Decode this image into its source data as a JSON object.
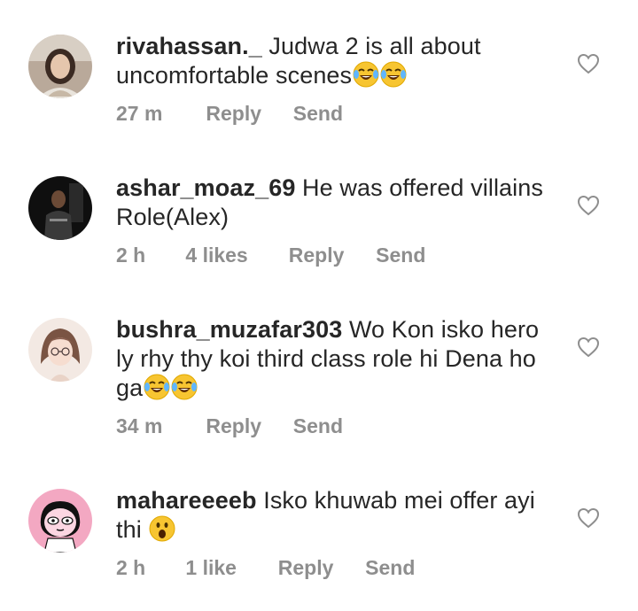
{
  "comments": [
    {
      "username": "rivahassan._",
      "text": "Judwa 2 is all about uncomfortable scenes",
      "emojis": [
        "😂",
        "😂"
      ],
      "time": "27 m",
      "likes": "",
      "reply_label": "Reply",
      "send_label": "Send"
    },
    {
      "username": "ashar_moaz_69",
      "text": "He was offered villains Role(Alex)",
      "emojis": [],
      "time": "2 h",
      "likes": "4 likes",
      "reply_label": "Reply",
      "send_label": "Send"
    },
    {
      "username": "bushra_muzafar303",
      "text": "Wo Kon isko hero ly rhy thy koi third class role hi Dena ho ga",
      "emojis": [
        "😂",
        "😂"
      ],
      "time": "34 m",
      "likes": "",
      "reply_label": "Reply",
      "send_label": "Send"
    },
    {
      "username": "mahareeeeb",
      "text": "Isko khuwab mei offer ayi thi",
      "emojis": [
        "😮"
      ],
      "time": "2 h",
      "likes": "1 like",
      "reply_label": "Reply",
      "send_label": "Send"
    }
  ],
  "colors": {
    "text": "#262626",
    "meta": "#8e8e8e"
  },
  "icons": {
    "like": "heart-outline-icon",
    "laugh": "face-with-tears-of-joy-icon",
    "surprised": "face-with-open-mouth-icon"
  }
}
